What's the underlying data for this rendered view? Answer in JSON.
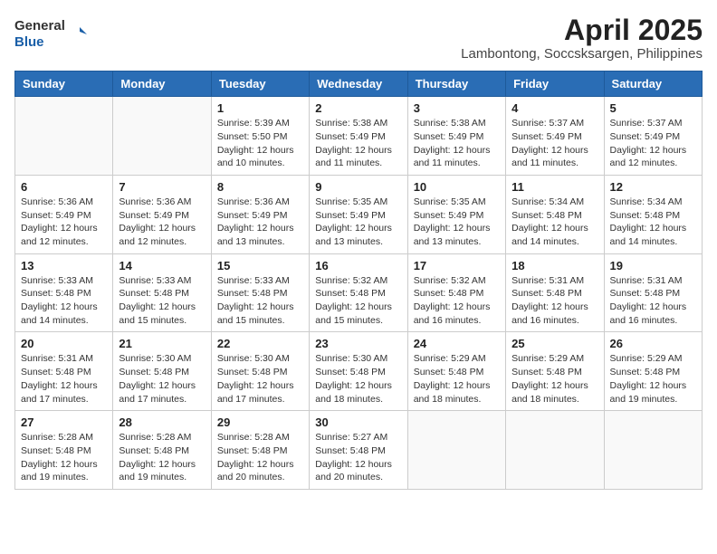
{
  "logo": {
    "general": "General",
    "blue": "Blue"
  },
  "title": "April 2025",
  "location": "Lambontong, Soccsksargen, Philippines",
  "weekdays": [
    "Sunday",
    "Monday",
    "Tuesday",
    "Wednesday",
    "Thursday",
    "Friday",
    "Saturday"
  ],
  "days": [
    {
      "day": "",
      "info": ""
    },
    {
      "day": "",
      "info": ""
    },
    {
      "day": "1",
      "info": "Sunrise: 5:39 AM\nSunset: 5:50 PM\nDaylight: 12 hours and 10 minutes."
    },
    {
      "day": "2",
      "info": "Sunrise: 5:38 AM\nSunset: 5:49 PM\nDaylight: 12 hours and 11 minutes."
    },
    {
      "day": "3",
      "info": "Sunrise: 5:38 AM\nSunset: 5:49 PM\nDaylight: 12 hours and 11 minutes."
    },
    {
      "day": "4",
      "info": "Sunrise: 5:37 AM\nSunset: 5:49 PM\nDaylight: 12 hours and 11 minutes."
    },
    {
      "day": "5",
      "info": "Sunrise: 5:37 AM\nSunset: 5:49 PM\nDaylight: 12 hours and 12 minutes."
    },
    {
      "day": "6",
      "info": "Sunrise: 5:36 AM\nSunset: 5:49 PM\nDaylight: 12 hours and 12 minutes."
    },
    {
      "day": "7",
      "info": "Sunrise: 5:36 AM\nSunset: 5:49 PM\nDaylight: 12 hours and 12 minutes."
    },
    {
      "day": "8",
      "info": "Sunrise: 5:36 AM\nSunset: 5:49 PM\nDaylight: 12 hours and 13 minutes."
    },
    {
      "day": "9",
      "info": "Sunrise: 5:35 AM\nSunset: 5:49 PM\nDaylight: 12 hours and 13 minutes."
    },
    {
      "day": "10",
      "info": "Sunrise: 5:35 AM\nSunset: 5:49 PM\nDaylight: 12 hours and 13 minutes."
    },
    {
      "day": "11",
      "info": "Sunrise: 5:34 AM\nSunset: 5:48 PM\nDaylight: 12 hours and 14 minutes."
    },
    {
      "day": "12",
      "info": "Sunrise: 5:34 AM\nSunset: 5:48 PM\nDaylight: 12 hours and 14 minutes."
    },
    {
      "day": "13",
      "info": "Sunrise: 5:33 AM\nSunset: 5:48 PM\nDaylight: 12 hours and 14 minutes."
    },
    {
      "day": "14",
      "info": "Sunrise: 5:33 AM\nSunset: 5:48 PM\nDaylight: 12 hours and 15 minutes."
    },
    {
      "day": "15",
      "info": "Sunrise: 5:33 AM\nSunset: 5:48 PM\nDaylight: 12 hours and 15 minutes."
    },
    {
      "day": "16",
      "info": "Sunrise: 5:32 AM\nSunset: 5:48 PM\nDaylight: 12 hours and 15 minutes."
    },
    {
      "day": "17",
      "info": "Sunrise: 5:32 AM\nSunset: 5:48 PM\nDaylight: 12 hours and 16 minutes."
    },
    {
      "day": "18",
      "info": "Sunrise: 5:31 AM\nSunset: 5:48 PM\nDaylight: 12 hours and 16 minutes."
    },
    {
      "day": "19",
      "info": "Sunrise: 5:31 AM\nSunset: 5:48 PM\nDaylight: 12 hours and 16 minutes."
    },
    {
      "day": "20",
      "info": "Sunrise: 5:31 AM\nSunset: 5:48 PM\nDaylight: 12 hours and 17 minutes."
    },
    {
      "day": "21",
      "info": "Sunrise: 5:30 AM\nSunset: 5:48 PM\nDaylight: 12 hours and 17 minutes."
    },
    {
      "day": "22",
      "info": "Sunrise: 5:30 AM\nSunset: 5:48 PM\nDaylight: 12 hours and 17 minutes."
    },
    {
      "day": "23",
      "info": "Sunrise: 5:30 AM\nSunset: 5:48 PM\nDaylight: 12 hours and 18 minutes."
    },
    {
      "day": "24",
      "info": "Sunrise: 5:29 AM\nSunset: 5:48 PM\nDaylight: 12 hours and 18 minutes."
    },
    {
      "day": "25",
      "info": "Sunrise: 5:29 AM\nSunset: 5:48 PM\nDaylight: 12 hours and 18 minutes."
    },
    {
      "day": "26",
      "info": "Sunrise: 5:29 AM\nSunset: 5:48 PM\nDaylight: 12 hours and 19 minutes."
    },
    {
      "day": "27",
      "info": "Sunrise: 5:28 AM\nSunset: 5:48 PM\nDaylight: 12 hours and 19 minutes."
    },
    {
      "day": "28",
      "info": "Sunrise: 5:28 AM\nSunset: 5:48 PM\nDaylight: 12 hours and 19 minutes."
    },
    {
      "day": "29",
      "info": "Sunrise: 5:28 AM\nSunset: 5:48 PM\nDaylight: 12 hours and 20 minutes."
    },
    {
      "day": "30",
      "info": "Sunrise: 5:27 AM\nSunset: 5:48 PM\nDaylight: 12 hours and 20 minutes."
    },
    {
      "day": "",
      "info": ""
    },
    {
      "day": "",
      "info": ""
    },
    {
      "day": "",
      "info": ""
    },
    {
      "day": "",
      "info": ""
    }
  ]
}
